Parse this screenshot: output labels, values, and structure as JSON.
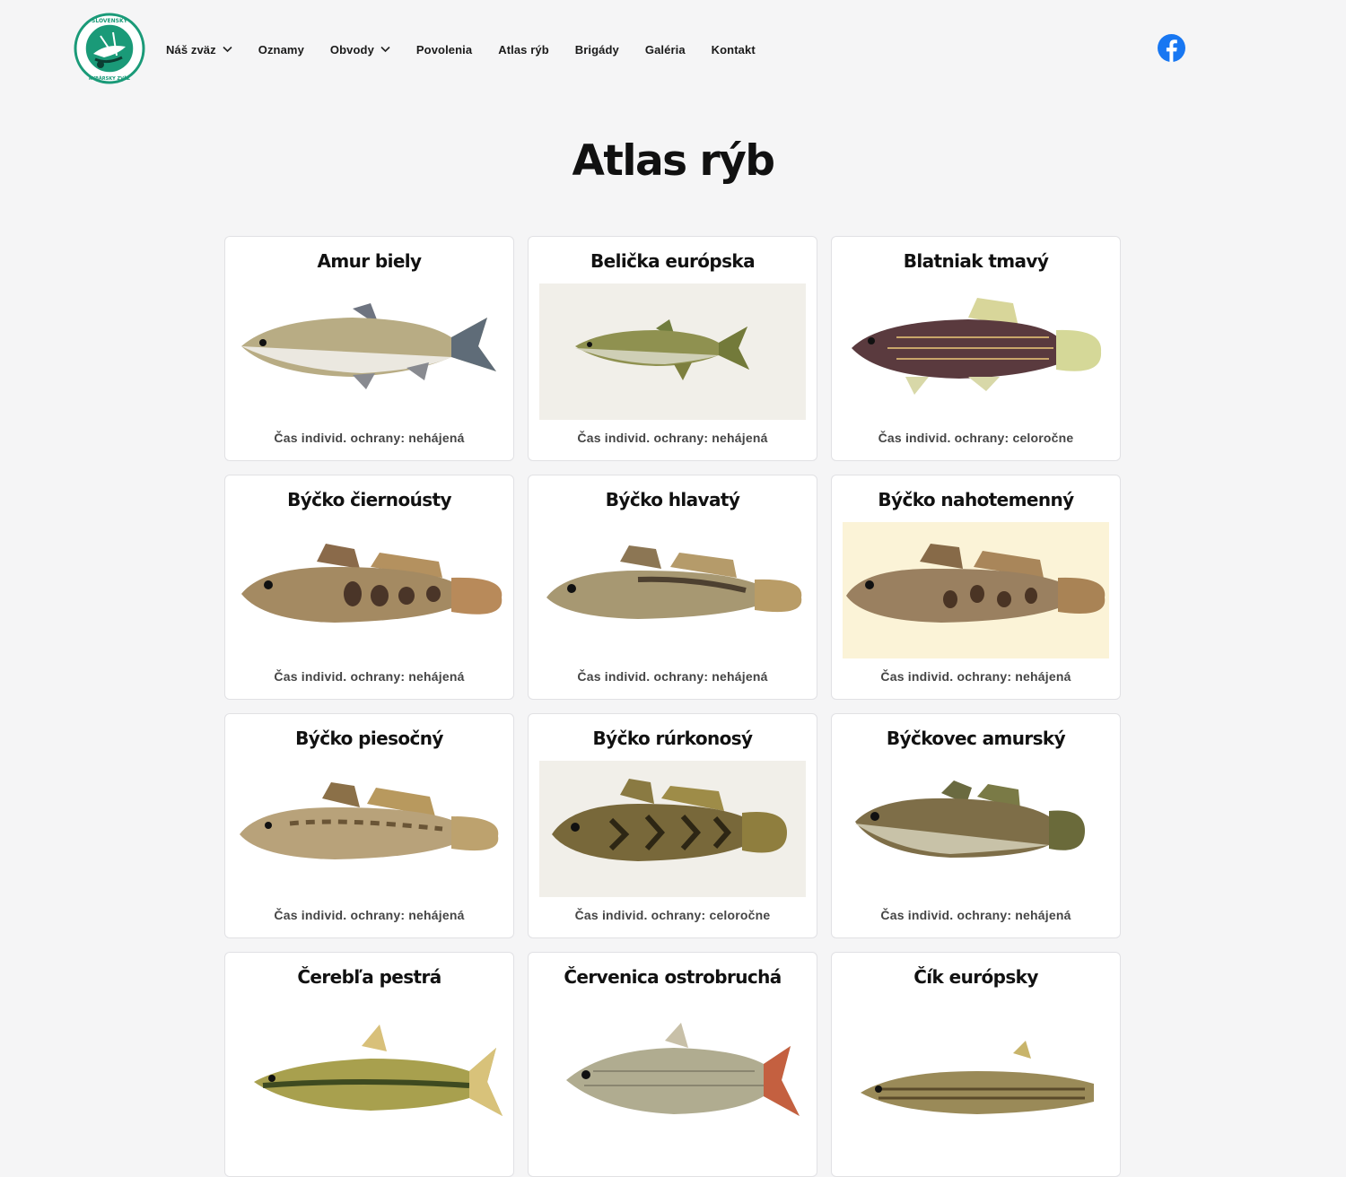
{
  "header": {
    "logo_text": [
      "SLOVENSKÝ",
      "RYBÁRSKY ZVÄZ"
    ],
    "nav": [
      {
        "label": "Náš zväz",
        "has_dropdown": true
      },
      {
        "label": "Oznamy",
        "has_dropdown": false
      },
      {
        "label": "Obvody",
        "has_dropdown": true
      },
      {
        "label": "Povolenia",
        "has_dropdown": false
      },
      {
        "label": "Atlas rýb",
        "has_dropdown": false
      },
      {
        "label": "Brigády",
        "has_dropdown": false
      },
      {
        "label": "Galéria",
        "has_dropdown": false
      },
      {
        "label": "Kontakt",
        "has_dropdown": false
      }
    ],
    "social_icon": "facebook-icon"
  },
  "main": {
    "title": "Atlas rýb",
    "cards": [
      {
        "name": "Amur biely",
        "protection": "Čas individ. ochrany: nehájená"
      },
      {
        "name": "Belička európska",
        "protection": "Čas individ. ochrany: nehájená"
      },
      {
        "name": "Blatniak tmavý",
        "protection": "Čas individ. ochrany: celoročne"
      },
      {
        "name": "Býčko čiernoústy",
        "protection": "Čas individ. ochrany: nehájená"
      },
      {
        "name": "Býčko hlavatý",
        "protection": "Čas individ. ochrany: nehájená"
      },
      {
        "name": "Býčko nahotemenný",
        "protection": "Čas individ. ochrany: nehájená"
      },
      {
        "name": "Býčko piesočný",
        "protection": "Čas individ. ochrany: nehájená"
      },
      {
        "name": "Býčko rúrkonosý",
        "protection": "Čas individ. ochrany: celoročne"
      },
      {
        "name": "Býčkovec amurský",
        "protection": "Čas individ. ochrany: nehájená"
      },
      {
        "name": "Čerebľa pestrá",
        "protection": ""
      },
      {
        "name": "Červenica ostrobruchá",
        "protection": ""
      },
      {
        "name": "Čík európsky",
        "protection": ""
      }
    ]
  },
  "colors": {
    "logo_green": "#1a9a78",
    "facebook_blue": "#1877f2",
    "background": "#f5f5f6"
  }
}
